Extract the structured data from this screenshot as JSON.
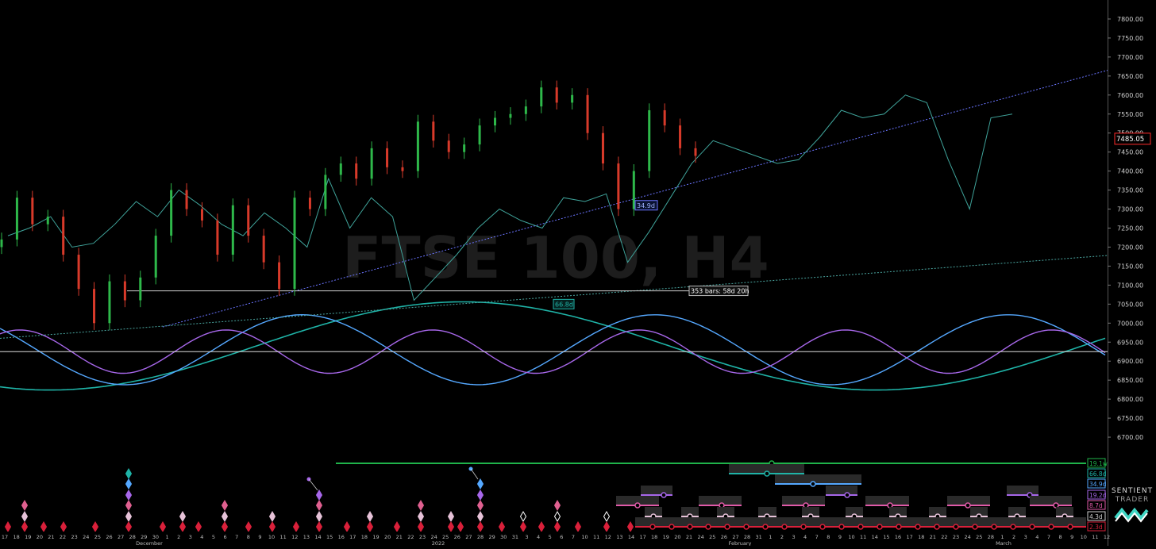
{
  "watermark": "FTSE 100, H4",
  "brand": {
    "line1": "SENTIENT",
    "line2": "TRADER"
  },
  "colors": {
    "background": "#000000",
    "candle_up": "#2eb84a",
    "candle_down": "#d83a2a",
    "price_line": "#3fa39a",
    "trend_line": "#6a74ff",
    "cycle_66d": "#1fb3a7",
    "cycle_34d": "#55a8ff",
    "cycle_19d": "#a767ea",
    "reference_line": "#dddddd",
    "current_price": "#ff2a2a"
  },
  "chart_data": {
    "type": "line",
    "title": "FTSE 100, H4",
    "y_axis": {
      "range": [
        6650,
        7850
      ],
      "ticks": [
        "6700.00",
        "6750.00",
        "6800.00",
        "6850.00",
        "6900.00",
        "6950.00",
        "7000.00",
        "7050.00",
        "7100.00",
        "7150.00",
        "7200.00",
        "7250.00",
        "7300.00",
        "7350.00",
        "7400.00",
        "7450.00",
        "7500.00",
        "7550.00",
        "7600.00",
        "7650.00",
        "7700.00",
        "7750.00",
        "7800.00"
      ]
    },
    "current_price": "7485.05",
    "x_axis": {
      "day_ticks": [
        "17",
        "18",
        "19",
        "20",
        "21",
        "22",
        "23",
        "24",
        "25",
        "26",
        "27",
        "28",
        "29",
        "30",
        "1",
        "2",
        "3",
        "4",
        "5",
        "6",
        "7",
        "8",
        "9",
        "10",
        "11",
        "12",
        "13",
        "14",
        "15",
        "16",
        "17",
        "18",
        "19",
        "20",
        "21",
        "22",
        "23",
        "24",
        "25",
        "26",
        "27",
        "28",
        "29",
        "30",
        "31",
        "3",
        "4",
        "5",
        "6",
        "7",
        "10",
        "11",
        "12",
        "13",
        "14",
        "17",
        "18",
        "19",
        "20",
        "21",
        "24",
        "25",
        "26",
        "27",
        "28",
        "31",
        "1",
        "2",
        "3",
        "4",
        "7",
        "8",
        "9",
        "10",
        "11",
        "14",
        "15",
        "16",
        "17",
        "18",
        "21",
        "22",
        "23",
        "24",
        "25",
        "28",
        "1",
        "2",
        "3",
        "4",
        "7",
        "8",
        "9",
        "10",
        "11",
        "12"
      ],
      "month_labels": [
        "December",
        "2022",
        "February",
        "March"
      ]
    },
    "series": [
      {
        "name": "",
        "kind": "candles",
        "values": [
          7220,
          7330,
          7260,
          7280,
          7180,
          7090,
          7000,
          7110,
          7060,
          7120,
          7230,
          7350,
          7300,
          7270,
          7180,
          7310,
          7230,
          7160,
          7090,
          7330,
          7300,
          7390,
          7420,
          7380,
          7460,
          7410,
          7400,
          7530,
          7480,
          7450,
          7470,
          7520,
          7540,
          7550,
          7570,
          7620,
          7580,
          7600,
          7500,
          7420,
          7300,
          7400,
          7560,
          7520,
          7460,
          7440
        ]
      },
      {
        "name": "",
        "kind": "line",
        "values": [
          7230,
          7250,
          7280,
          7200,
          7210,
          7260,
          7320,
          7280,
          7350,
          7310,
          7260,
          7230,
          7290,
          7250,
          7200,
          7380,
          7250,
          7330,
          7280,
          7060,
          7120,
          7180,
          7250,
          7300,
          7270,
          7250,
          7330,
          7320,
          7340,
          7160,
          7240,
          7330,
          7420,
          7480,
          7460,
          7440,
          7420,
          7430,
          7490,
          7560,
          7540,
          7550,
          7600,
          7580,
          7430,
          7300,
          7540,
          7550
        ]
      }
    ],
    "cycles": [
      {
        "period": "66.8d",
        "label": "66.8d"
      },
      {
        "period": "34.9d",
        "label": "34.9d"
      },
      {
        "period": "19.2d",
        "label": "19.2d"
      }
    ],
    "reference_level": 6925,
    "annotations": [
      {
        "text": "353 bars: 58d 20h"
      },
      {
        "text": "34.9d"
      },
      {
        "text": "66.8d"
      }
    ],
    "legend_right": [
      "19.1w",
      "66.8d",
      "34.9d",
      "19.2d",
      "8.7d",
      "4.3d",
      "2.3d"
    ]
  }
}
